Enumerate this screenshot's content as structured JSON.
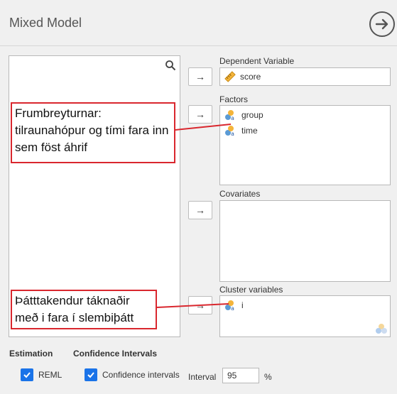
{
  "header": {
    "title": "Mixed Model"
  },
  "arrow_glyph": "→",
  "targets": {
    "dependent": {
      "label": "Dependent Variable",
      "items": [
        {
          "name": "score",
          "icon": "ruler-icon"
        }
      ]
    },
    "factors": {
      "label": "Factors",
      "items": [
        {
          "name": "group",
          "icon": "nominal-icon"
        },
        {
          "name": "time",
          "icon": "nominal-icon"
        }
      ]
    },
    "covariates": {
      "label": "Covariates",
      "items": []
    },
    "cluster": {
      "label": "Cluster variables",
      "items": [
        {
          "name": "i",
          "icon": "nominal-icon"
        }
      ]
    }
  },
  "annotations": {
    "factors_note": "Frumbreyturnar: tilraunahópur og tími fara inn sem föst áhrif",
    "cluster_note": "Þátttakendur táknaðir með i fara í slembiþátt"
  },
  "options": {
    "estimation_title": "Estimation",
    "reml_label": "REML",
    "reml_checked": true,
    "ci_title": "Confidence Intervals",
    "ci_label": "Confidence intervals",
    "ci_checked": true,
    "interval_label": "Interval",
    "interval_value": "95",
    "interval_unit": "%"
  },
  "colors": {
    "accent": "#1a73e8",
    "annotation_red": "#d9272e",
    "panel": "#f0f0f0"
  }
}
